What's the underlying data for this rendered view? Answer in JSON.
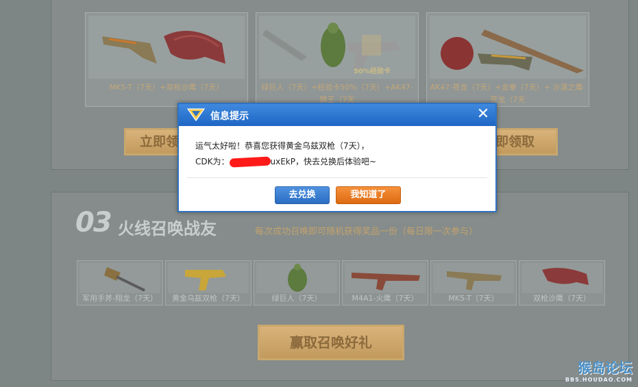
{
  "prizes": [
    {
      "caption": "MK5-T（7天）+双枪沙鹰（7天）"
    },
    {
      "caption": "绿巨人（7天）+经验卡50%（7天）+AK47-狮王（7天",
      "tag": "50%经验卡"
    },
    {
      "caption": "AK47-苍龙（7天）+龙拳（7天）+ 沙漠之鹰-苍龙（7天"
    }
  ],
  "claim_buttons": {
    "left": "立即领",
    "right": "即领取"
  },
  "section": {
    "number": "03",
    "title": "火线召唤战友",
    "subtitle": "每次成功召唤即可随机获得奖品一份（每日限一次参与）"
  },
  "rewards": [
    {
      "label": "军用手斧-翔龙（7天）"
    },
    {
      "label": "黄金乌兹双枪（7天）"
    },
    {
      "label": "绿巨人（7天）"
    },
    {
      "label": "M4A1-火鹰（7天）"
    },
    {
      "label": "MK5-T（7天）"
    },
    {
      "label": "双枪沙鹰（7天）"
    }
  ],
  "summon_button": "赢取召唤好礼",
  "watermark": {
    "main": "猴岛论坛",
    "url": "BBS.HOUDAO.COM"
  },
  "dialog": {
    "title": "信息提示",
    "close_symbol": "✕",
    "line1": "运气太好啦！恭喜您获得黄金乌兹双枪（7天），",
    "cdk_prefix": "CDK为：",
    "cdk_suffix": "uxEkP，快去兑换后体验吧~",
    "redeem_label": "去兑换",
    "ok_label": "我知道了"
  }
}
